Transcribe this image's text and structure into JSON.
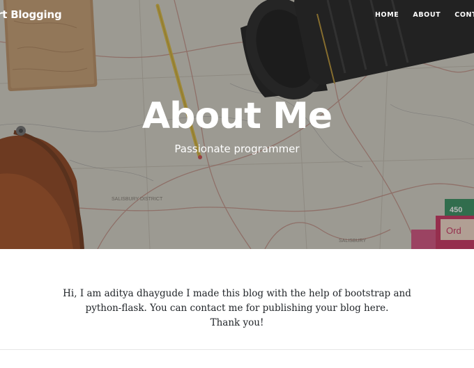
{
  "navbar": {
    "brand": "rt Blogging",
    "links": [
      "HOME",
      "ABOUT",
      "CONTA"
    ]
  },
  "hero": {
    "title": "About Me",
    "subtitle": "Passionate programmer",
    "map_labels": [
      "SALISBURY DISTRICT",
      "SALISBURY"
    ],
    "product_labels": [
      "450",
      "Ord"
    ]
  },
  "content": {
    "line1": "Hi, I am aditya dhaygude I made this blog with the help of bootstrap and",
    "line2": "python-flask. You can contact me for publishing your blog here.",
    "line3": "Thank you!"
  }
}
